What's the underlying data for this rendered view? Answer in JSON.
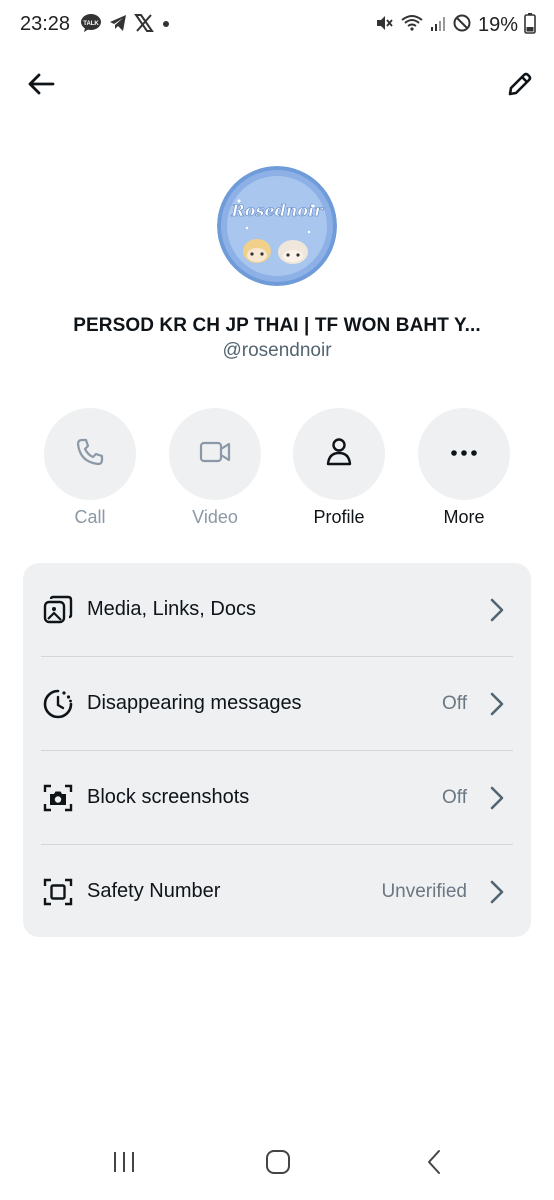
{
  "status_bar": {
    "time": "23:28",
    "battery": "19%",
    "left_icons": [
      "talk-icon",
      "telegram-icon",
      "x-icon",
      "dot-icon"
    ],
    "right_icons": [
      "mute-icon",
      "wifi-icon",
      "signal-icon",
      "block-icon",
      "battery-icon"
    ]
  },
  "header": {
    "back_icon": "back-arrow-icon",
    "edit_icon": "pencil-icon"
  },
  "profile": {
    "avatar_text": "Rosednoir",
    "display_name": "PERSOD KR CH JP THAI | TF WON BAHT Y...",
    "handle": "@rosendnoir"
  },
  "actions": [
    {
      "label": "Call",
      "icon": "phone-icon",
      "enabled": false
    },
    {
      "label": "Video",
      "icon": "video-icon",
      "enabled": false
    },
    {
      "label": "Profile",
      "icon": "person-icon",
      "enabled": true
    },
    {
      "label": "More",
      "icon": "more-icon",
      "enabled": true
    }
  ],
  "settings": [
    {
      "title": "Media, Links, Docs",
      "value": "",
      "icon": "media-icon"
    },
    {
      "title": "Disappearing messages",
      "value": "Off",
      "icon": "timer-icon"
    },
    {
      "title": "Block screenshots",
      "value": "Off",
      "icon": "camera-icon"
    },
    {
      "title": "Safety Number",
      "value": "Unverified",
      "icon": "safety-icon"
    }
  ],
  "colors": {
    "secondary_text": "#536471",
    "card_background": "#eef0f2",
    "avatar_background": "#6f9bd9"
  }
}
